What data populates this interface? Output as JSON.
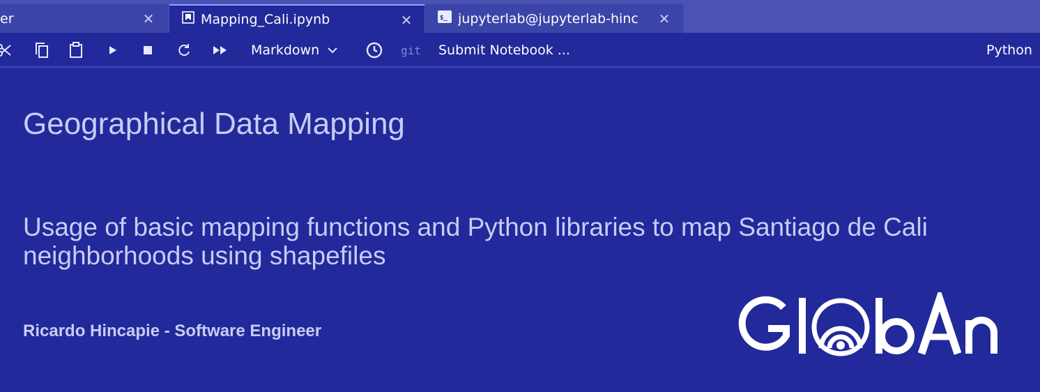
{
  "tabs": [
    {
      "label": "er",
      "icon": "none",
      "active": false
    },
    {
      "label": "Mapping_Cali.ipynb",
      "icon": "notebook-icon",
      "active": true
    },
    {
      "label": "jupyterlab@jupyterlab-hinc",
      "icon": "terminal-icon",
      "active": false
    }
  ],
  "toolbar": {
    "cell_type": "Markdown",
    "git_label": "git",
    "submit_label": "Submit Notebook ...",
    "kernel_name": "Python"
  },
  "notebook": {
    "title": "Geographical Data Mapping",
    "subtitle_line1": "Usage of basic mapping functions and Python libraries to map Santiago de Cali",
    "subtitle_line2": "neighborhoods using shapefiles",
    "author": "Ricardo Hincapie - Software Engineer",
    "logo_text": "GlobAn"
  },
  "colors": {
    "background": "#22299a",
    "tabbar": "#4a53b4",
    "text_light": "#c7cdf5"
  }
}
